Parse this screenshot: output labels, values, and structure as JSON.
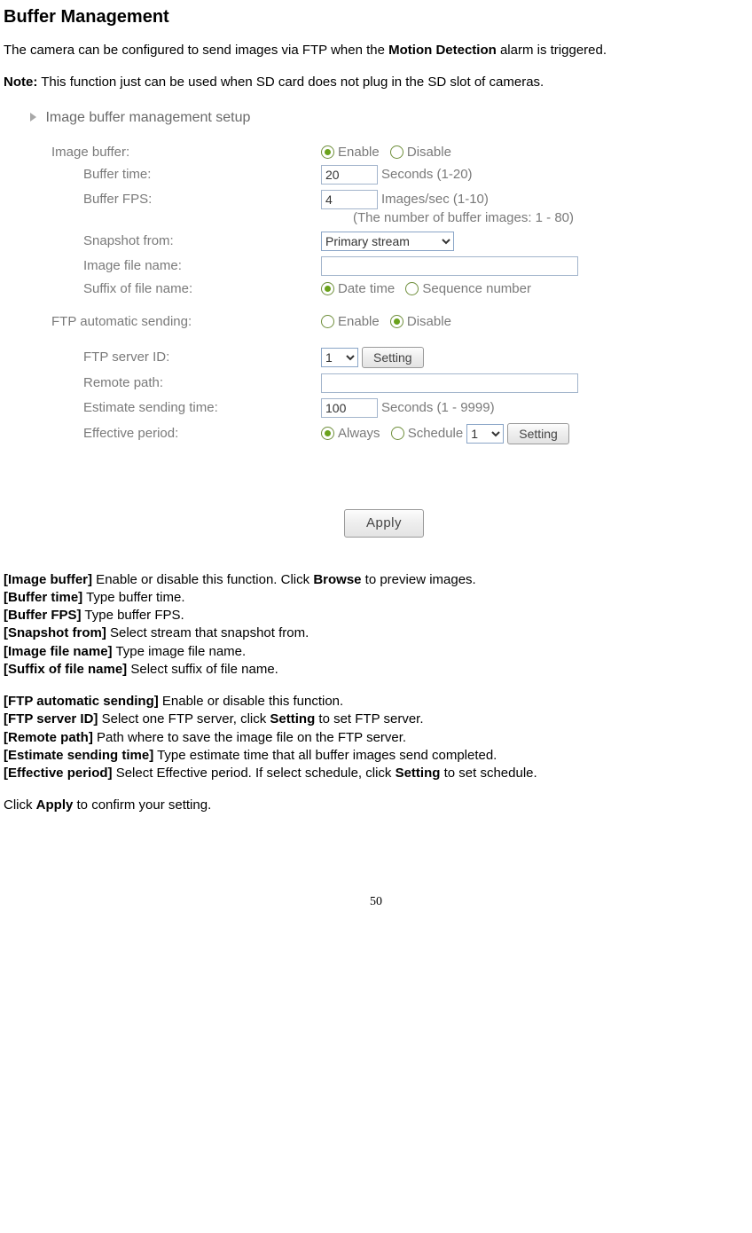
{
  "heading": "Buffer Management",
  "intro_pre": "The camera can be configured to send images via FTP when the ",
  "intro_bold": "Motion Detection",
  "intro_post": " alarm is triggered.",
  "note_label": "Note:",
  "note_text": " This function just can be used when SD card does not plug in the SD slot of cameras.",
  "form": {
    "title": "Image buffer management setup",
    "image_buffer": {
      "label": "Image buffer:",
      "enable": "Enable",
      "disable": "Disable",
      "selected": "enable"
    },
    "buffer_time": {
      "label": "Buffer time:",
      "value": "20",
      "suffix": "Seconds (1-20)"
    },
    "buffer_fps": {
      "label": "Buffer FPS:",
      "value": "4",
      "suffix": "Images/sec (1-10)"
    },
    "buffer_images_note": "(The number of buffer images: 1 - 80)",
    "snapshot_from": {
      "label": "Snapshot from:",
      "value": "Primary stream"
    },
    "image_file_name": {
      "label": "Image file name:",
      "value": ""
    },
    "suffix_of_file_name": {
      "label": "Suffix of file name:",
      "opt1": "Date time",
      "opt2": "Sequence number",
      "selected": "date_time"
    },
    "ftp_auto": {
      "label": "FTP automatic sending:",
      "enable": "Enable",
      "disable": "Disable",
      "selected": "disable"
    },
    "ftp_server_id": {
      "label": "FTP server ID:",
      "value": "1",
      "setting": "Setting"
    },
    "remote_path": {
      "label": "Remote path:",
      "value": ""
    },
    "estimate_time": {
      "label": "Estimate sending time:",
      "value": "100",
      "suffix": "Seconds (1 - 9999)"
    },
    "effective_period": {
      "label": "Effective period:",
      "always": "Always",
      "schedule": "Schedule",
      "selected": "always",
      "schedule_id": "1",
      "setting": "Setting"
    },
    "apply": "Apply"
  },
  "definitions": {
    "items1": [
      {
        "key": "[Image buffer]",
        "text": " Enable or disable this function. Click ",
        "bold2": "Browse",
        "text2": " to preview images."
      },
      {
        "key": "[Buffer time]",
        "text": " Type buffer time."
      },
      {
        "key": "[Buffer FPS]",
        "text": " Type buffer FPS."
      },
      {
        "key": "[Snapshot from]",
        "text": " Select stream that snapshot from."
      },
      {
        "key": "[Image file name]",
        "text": " Type image file name."
      },
      {
        "key": "[Suffix of file name]",
        "text": " Select suffix of file name."
      }
    ],
    "items2": [
      {
        "key": "[FTP automatic sending]",
        "text": " Enable or disable this function."
      },
      {
        "key": "[FTP server ID]",
        "text": " Select one FTP server, click ",
        "bold2": "Setting",
        "text2": " to set FTP server."
      },
      {
        "key": "[Remote path]",
        "text": " Path where to save the image file on the FTP server."
      },
      {
        "key": "[Estimate sending time]",
        "text": " Type estimate time that all buffer images send completed."
      },
      {
        "key": "[Effective period]",
        "text": " Select Effective period. If select schedule, click ",
        "bold2": "Setting",
        "text2": " to set schedule."
      }
    ]
  },
  "closing_pre": "Click ",
  "closing_bold": "Apply",
  "closing_post": " to confirm your setting.",
  "page_number": "50"
}
